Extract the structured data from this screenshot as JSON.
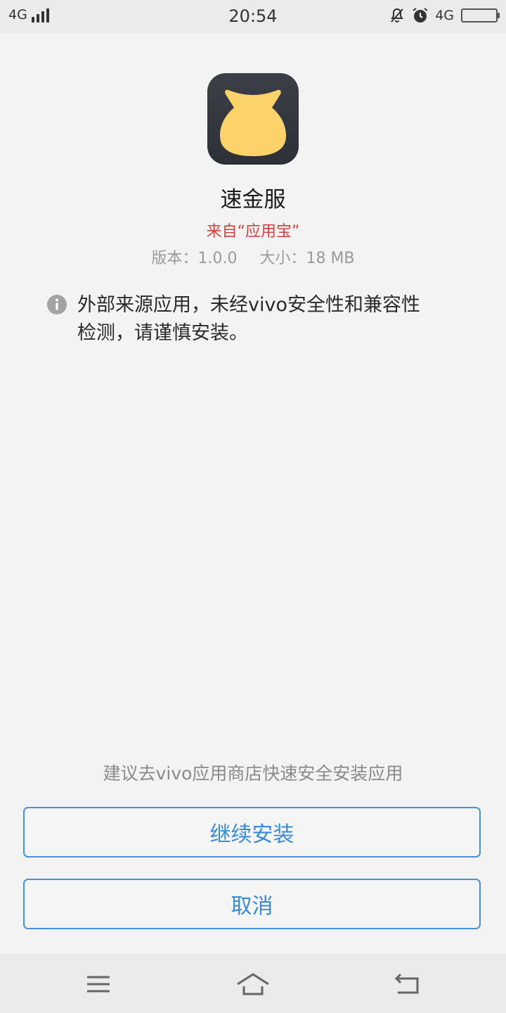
{
  "status_bar": {
    "network_left": "4G",
    "time": "20:54",
    "network_right": "4G"
  },
  "installer": {
    "app_name": "速金服",
    "source": "来自“应用宝”",
    "version": "版本：1.0.0",
    "size": "大小：18 MB",
    "warning_line1": "外部来源应用，未经vivo安全性和兼容性",
    "warning_line2": "检测，请谨慎安装。",
    "suggestion": "建议去vivo应用商店快速安全安装应用",
    "continue_label": "继续安装",
    "cancel_label": "取消"
  },
  "icons": {
    "app_icon": "money-bag-icon",
    "info": "info-icon",
    "nav_menu": "menu-icon",
    "nav_home": "home-icon",
    "nav_back": "back-icon"
  },
  "colors": {
    "source_red": "#d0423f",
    "button_blue": "#3a8ad6",
    "icon_yellow": "#fcd36b",
    "icon_dark": "#33353d"
  }
}
